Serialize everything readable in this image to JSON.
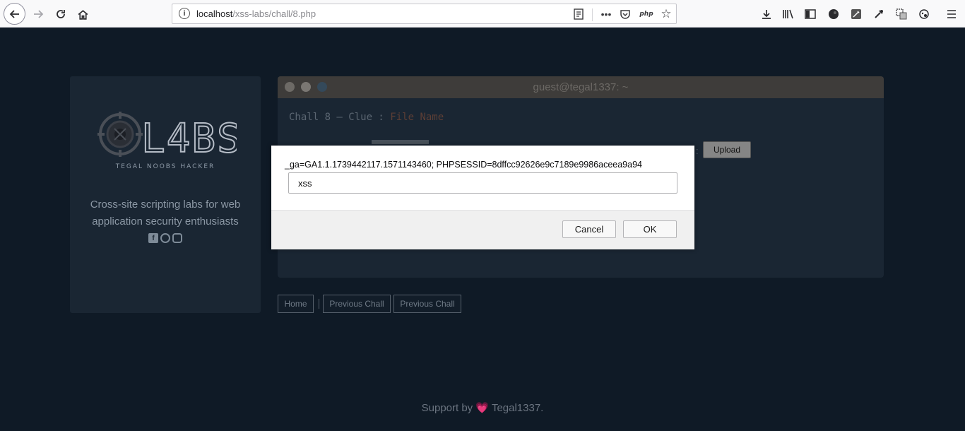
{
  "browser": {
    "url_host": "localhost",
    "url_path": "/xss-labs/chall/8.php",
    "php_label": "php",
    "icons": [
      "back-icon",
      "forward-icon",
      "reload-icon",
      "home-icon",
      "info-icon",
      "reader-view-icon",
      "more-icon",
      "pocket-icon",
      "php-icon",
      "bookmark-star-icon",
      "download-icon",
      "library-icon",
      "sidebar-icon",
      "extension-dark-icon",
      "extension-edit-icon",
      "eyedropper-icon",
      "screenshot-icon",
      "extension-palette-icon",
      "menu-icon"
    ]
  },
  "sidebar": {
    "logo_text": "L4BS",
    "tagline": "TEGAL NOOBS HACKER",
    "description": "Cross-site scripting labs for web application security enthusiasts",
    "social_icons": [
      "facebook-icon",
      "github-icon",
      "instagram-icon"
    ]
  },
  "terminal": {
    "title": "guest@tegal1337: ~",
    "clue_prefix": "Chall 8 — Clue : ",
    "clue_value": "File Name",
    "upload_label": "Upload",
    "ghost_colon": ":"
  },
  "nav": {
    "home": "Home",
    "prev1": "Previous Chall",
    "prev2": "Previous Chall"
  },
  "footer": {
    "prefix": "Support by ",
    "heart": "💗",
    "suffix": " Tegal1337."
  },
  "dialog": {
    "message": "_ga=GA1.1.1739442117.1571143460; PHPSESSID=8dffcc92626e9c7189e9986aceea9a94",
    "input_value": "xss",
    "cancel_label": "Cancel",
    "ok_label": "OK"
  },
  "colors": {
    "page_bg": "#0f1a26",
    "panel_bg": "#1a2633",
    "terminal_bar": "#3e3c3a"
  }
}
